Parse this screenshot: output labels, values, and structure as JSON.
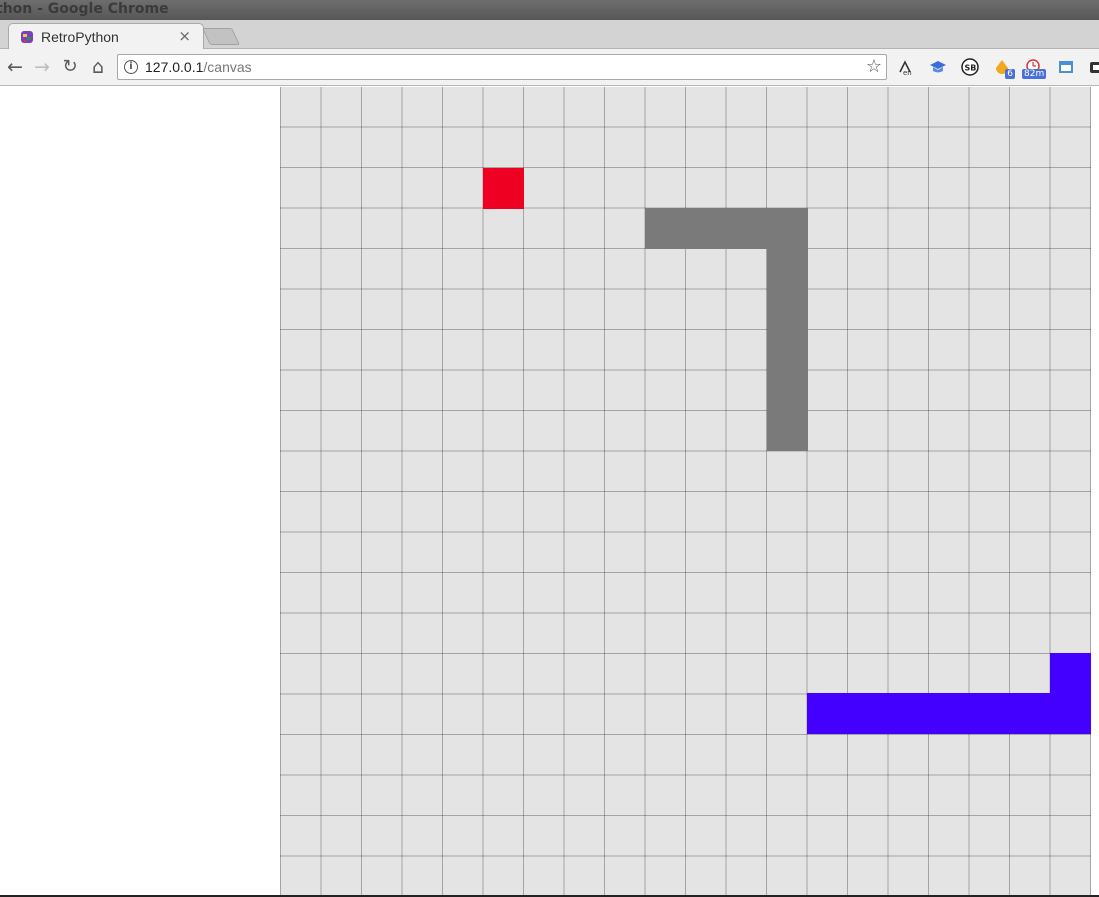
{
  "window": {
    "title": "thon - Google Chrome"
  },
  "tab": {
    "title": "RetroPython",
    "close": "×"
  },
  "nav": {
    "back": "←",
    "forward": "→",
    "reload": "↻",
    "home": "⌂"
  },
  "address": {
    "host": "127.0.0.1",
    "path": "/canvas",
    "info": "i",
    "star": "☆"
  },
  "extensions": [
    {
      "icon": "translate-icon"
    },
    {
      "icon": "graduation-cap-icon"
    },
    {
      "icon": "sb-icon",
      "label": "SB"
    },
    {
      "icon": "honey-icon",
      "badge": "6"
    },
    {
      "icon": "timer-icon",
      "badge": "82m"
    },
    {
      "icon": "window-icon"
    },
    {
      "icon": "lock-icon"
    }
  ],
  "game": {
    "grid": {
      "columns": 20,
      "rows": 20
    },
    "colors": {
      "background": "#e4e4e4",
      "food": "#ee0022",
      "snake_gray": "#7a7a7a",
      "snake_blue": "#4400ff"
    },
    "food": [
      [
        5,
        2
      ]
    ],
    "snake_gray": [
      [
        9,
        3
      ],
      [
        10,
        3
      ],
      [
        11,
        3
      ],
      [
        12,
        3
      ],
      [
        12,
        4
      ],
      [
        12,
        5
      ],
      [
        12,
        6
      ],
      [
        12,
        7
      ],
      [
        12,
        8
      ]
    ],
    "snake_blue": [
      [
        19,
        14
      ],
      [
        19,
        15
      ],
      [
        18,
        15
      ],
      [
        17,
        15
      ],
      [
        16,
        15
      ],
      [
        15,
        15
      ],
      [
        14,
        15
      ],
      [
        13,
        15
      ]
    ]
  }
}
